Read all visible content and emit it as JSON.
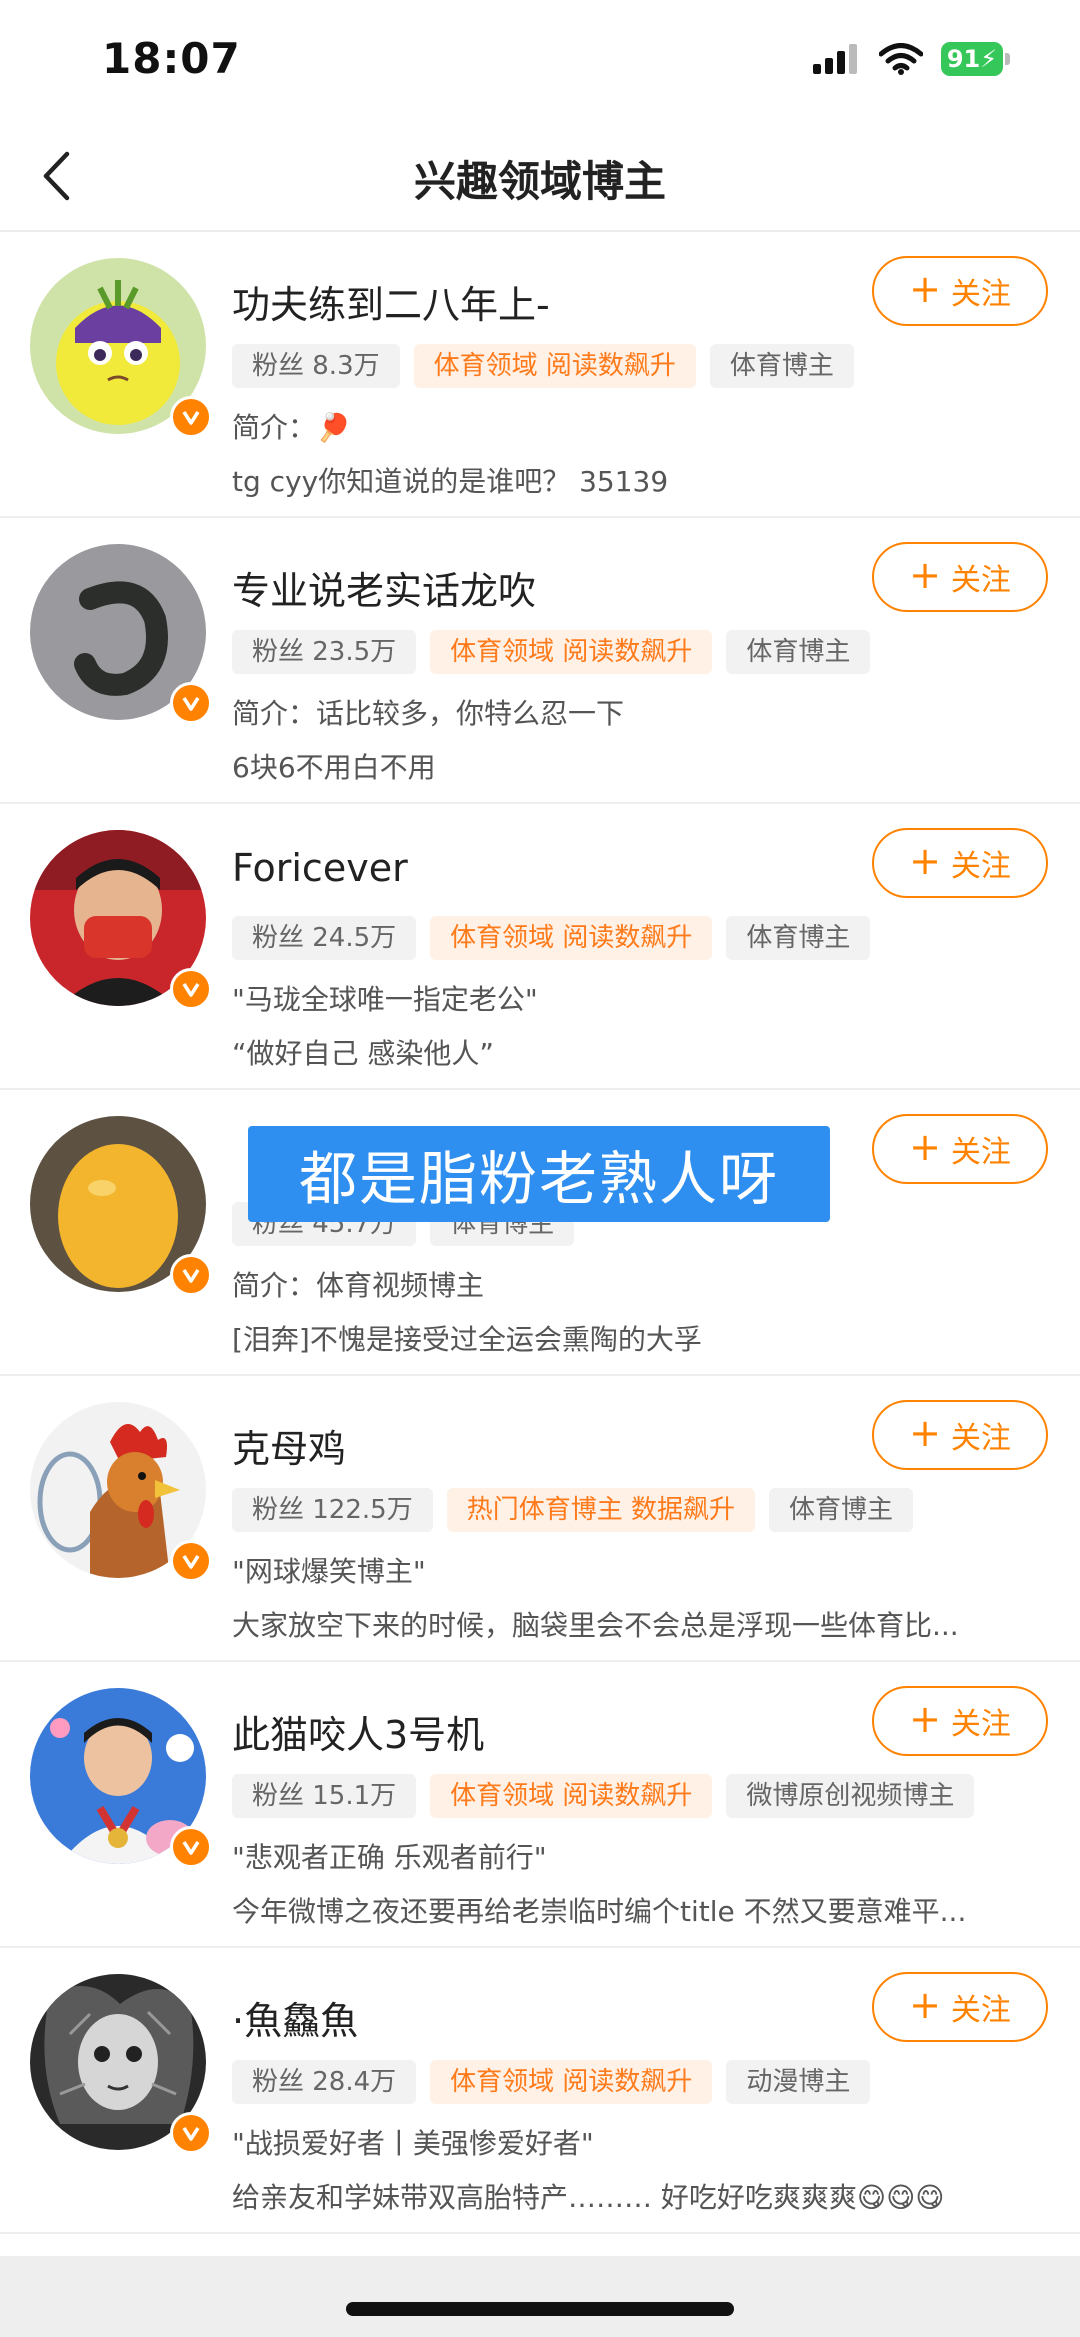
{
  "status_bar": {
    "time": "18:07",
    "battery": "91"
  },
  "nav": {
    "title": "兴趣领域博主"
  },
  "follow_label": "关注",
  "overlay_caption": "都是脂粉老熟人呀",
  "bloggers": [
    {
      "name": "功夫练到二八年上-",
      "tags": [
        {
          "text": "粉丝 8.3万",
          "style": "gray"
        },
        {
          "text": "体育领域 阅读数飙升",
          "style": "orange"
        },
        {
          "text": "体育博主",
          "style": "gray"
        }
      ],
      "bio_line1": "简介：🏓",
      "bio_line2": "tg cyy你知道说的是谁吧？ 35139"
    },
    {
      "name": "专业说老实话龙吹",
      "tags": [
        {
          "text": "粉丝 23.5万",
          "style": "gray"
        },
        {
          "text": "体育领域 阅读数飙升",
          "style": "orange"
        },
        {
          "text": "体育博主",
          "style": "gray"
        }
      ],
      "bio_line1": "简介：话比较多，你特么忍一下",
      "bio_line2": "6块6不用白不用"
    },
    {
      "name": "Foricever",
      "tags": [
        {
          "text": "粉丝 24.5万",
          "style": "gray"
        },
        {
          "text": "体育领域 阅读数飙升",
          "style": "orange"
        },
        {
          "text": "体育博主",
          "style": "gray"
        }
      ],
      "bio_line1": "\"马珑全球唯一指定老公\"",
      "bio_line2": "“做好自己 感染他人”"
    },
    {
      "name": "",
      "tags": [
        {
          "text": "粉丝 45.7万",
          "style": "gray"
        },
        {
          "text": "体育博主",
          "style": "gray"
        }
      ],
      "bio_line1": "简介：体育视频博主",
      "bio_line2": "[泪奔]不愧是接受过全运会熏陶的大孚"
    },
    {
      "name": "克母鸡",
      "tags": [
        {
          "text": "粉丝 122.5万",
          "style": "gray"
        },
        {
          "text": "热门体育博主 数据飙升",
          "style": "orange"
        },
        {
          "text": "体育博主",
          "style": "gray"
        }
      ],
      "bio_line1": "\"网球爆笑博主\"",
      "bio_line2": "大家放空下来的时候，脑袋里会不会总是浮现一些体育比..."
    },
    {
      "name": "此猫咬人3号机",
      "tags": [
        {
          "text": "粉丝 15.1万",
          "style": "gray"
        },
        {
          "text": "体育领域 阅读数飙升",
          "style": "orange"
        },
        {
          "text": "微博原创视频博主",
          "style": "gray"
        }
      ],
      "bio_line1": "\"悲观者正确 乐观者前行\"",
      "bio_line2": "今年微博之夜还要再给老崇临时编个title 不然又要意难平..."
    },
    {
      "name": "·魚鱻魚",
      "tags": [
        {
          "text": "粉丝 28.4万",
          "style": "gray"
        },
        {
          "text": "体育领域 阅读数飙升",
          "style": "orange"
        },
        {
          "text": "动漫博主",
          "style": "gray"
        }
      ],
      "bio_line1": "\"战损爱好者丨美强惨爱好者\"",
      "bio_line2": "给亲友和学妹带双高胎特产……… 好吃好吃爽爽爽😋😋😋"
    }
  ]
}
